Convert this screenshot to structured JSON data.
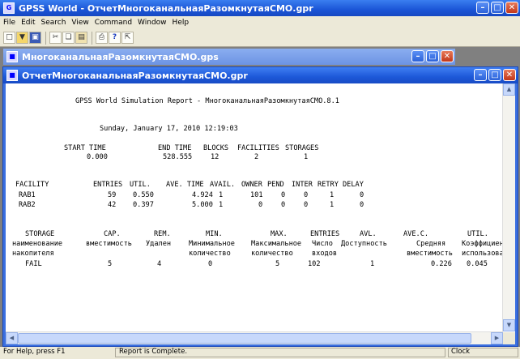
{
  "app": {
    "title": "GPSS World - ОтчетМногоканальнаяРазомкнутаяСМО.gpr"
  },
  "menu": [
    "File",
    "Edit",
    "Search",
    "View",
    "Command",
    "Window",
    "Help"
  ],
  "toolbar": {
    "icons": [
      "new-file-icon",
      "open-folder-icon",
      "save-icon",
      "cut-icon",
      "copy-icon",
      "paste-icon",
      "print-icon",
      "help-icon",
      "context-help-icon"
    ]
  },
  "windows": {
    "model": {
      "title": "МногоканальнаяРазомкнутаяСМО.gps"
    },
    "report": {
      "title": "ОтчетМногоканальнаяРазомкнутаяСМО.gpr"
    }
  },
  "report": {
    "header": "GPSS World Simulation Report - МногоканальнаяРазомкнутаяСМО.8.1",
    "date": "Sunday, January 17, 2010 12:19:03",
    "summary": {
      "headers": [
        "START TIME",
        "END TIME",
        "BLOCKS",
        "FACILITIES",
        "STORAGES"
      ],
      "values": [
        "0.000",
        "528.555",
        "12",
        "2",
        "1"
      ]
    },
    "facility_headers": [
      "FACILITY",
      "ENTRIES",
      "UTIL.",
      "AVE. TIME",
      "AVAIL.",
      "OWNER",
      "PEND",
      "INTER",
      "RETRY",
      "DELAY"
    ],
    "facilities": [
      [
        "RAB1",
        "59",
        "0.550",
        "4.924",
        "1",
        "101",
        "0",
        "0",
        "1",
        "0"
      ],
      [
        "RAB2",
        "42",
        "0.397",
        "5.000",
        "1",
        "0",
        "0",
        "0",
        "1",
        "0"
      ]
    ],
    "storage_headers": [
      "STORAGE",
      "CAP.",
      "REM.",
      "MIN.",
      "MAX.",
      "ENTRIES",
      "AVL.",
      "AVE.C.",
      "UTIL."
    ],
    "storage_ru_line1": [
      "наименование",
      "вместимость",
      "Удален",
      "Минимальное",
      "Максимальное",
      "Число",
      "Доступность",
      "Средняя",
      "Коэффициент"
    ],
    "storage_ru_line2": [
      "накопителя",
      "",
      "",
      "количество",
      "количество",
      "входов",
      "",
      "вместимость",
      "использован"
    ],
    "storages": [
      [
        "FAIL",
        "5",
        "4",
        "0",
        "5",
        "102",
        "1",
        "0.226",
        "0.045"
      ]
    ]
  },
  "status": {
    "help": "For Help, press F1",
    "message": "Report is Complete.",
    "clock": "Clock"
  }
}
